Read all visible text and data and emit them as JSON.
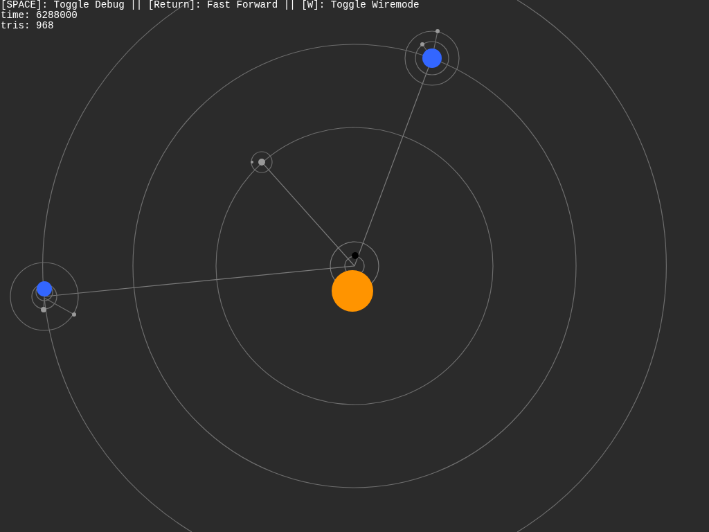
{
  "debug_overlay": {
    "controls_hint": "[SPACE]: Toggle Debug || [Return]: Fast Forward || [W]: Toggle Wiremode",
    "time": "time: 6288000",
    "tris": "tris: 968"
  }
}
